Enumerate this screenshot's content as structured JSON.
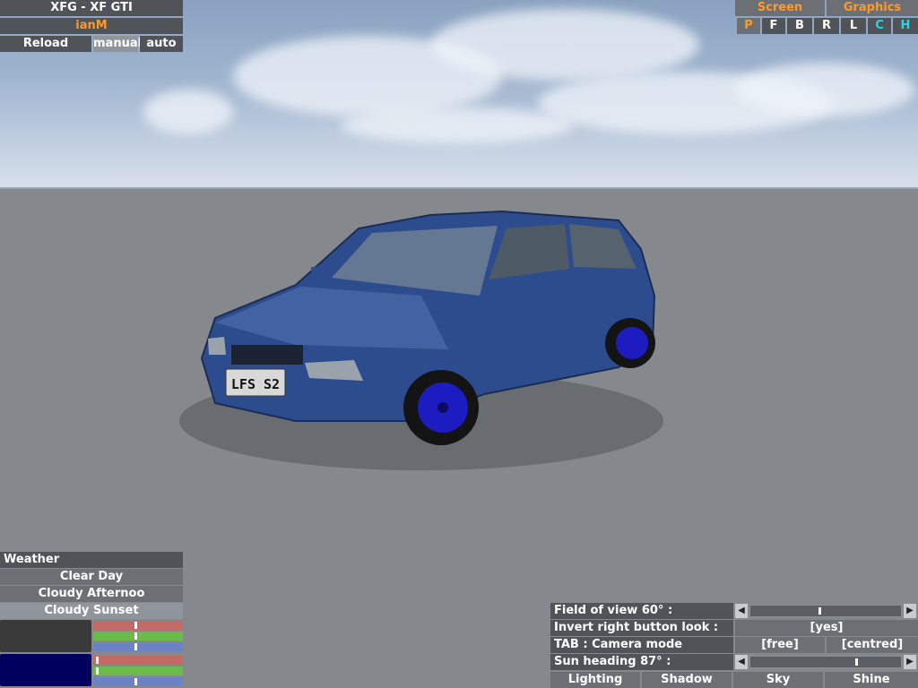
{
  "top_left": {
    "car_name": "XFG - XF GTI",
    "player": "ianM",
    "buttons": [
      "Reload",
      "manual",
      "auto"
    ]
  },
  "top_right": {
    "tabs": [
      "Screen",
      "Graphics"
    ],
    "keys": [
      "P",
      "F",
      "B",
      "R",
      "L",
      "C",
      "H"
    ]
  },
  "weather": {
    "title": "Weather",
    "options": [
      "Clear Day",
      "Cloudy Afternoo",
      "Cloudy Sunset"
    ],
    "swatch_colors": [
      "#3a3a3a",
      "#00005e"
    ],
    "sliders_top": [
      0.47,
      0.47,
      0.47
    ],
    "sliders_bottom": [
      0.03,
      0.03,
      0.47
    ]
  },
  "view": {
    "fov_label": "Field of view 60° :",
    "fov_value": 0.46,
    "invert_label": "Invert right button look :",
    "invert_value": "[yes]",
    "tab_label": "TAB : Camera mode",
    "tab_options": [
      "[free]",
      "[centred]"
    ],
    "sun_label": "Sun heading 87° :",
    "sun_value": 0.71,
    "bottom_tabs": [
      "Lighting",
      "Shadow",
      "Sky",
      "Shine"
    ]
  },
  "car": {
    "plate": "LFS S2",
    "body_color": "#2a4a8c",
    "wheel_color": "#1a1ac8"
  }
}
